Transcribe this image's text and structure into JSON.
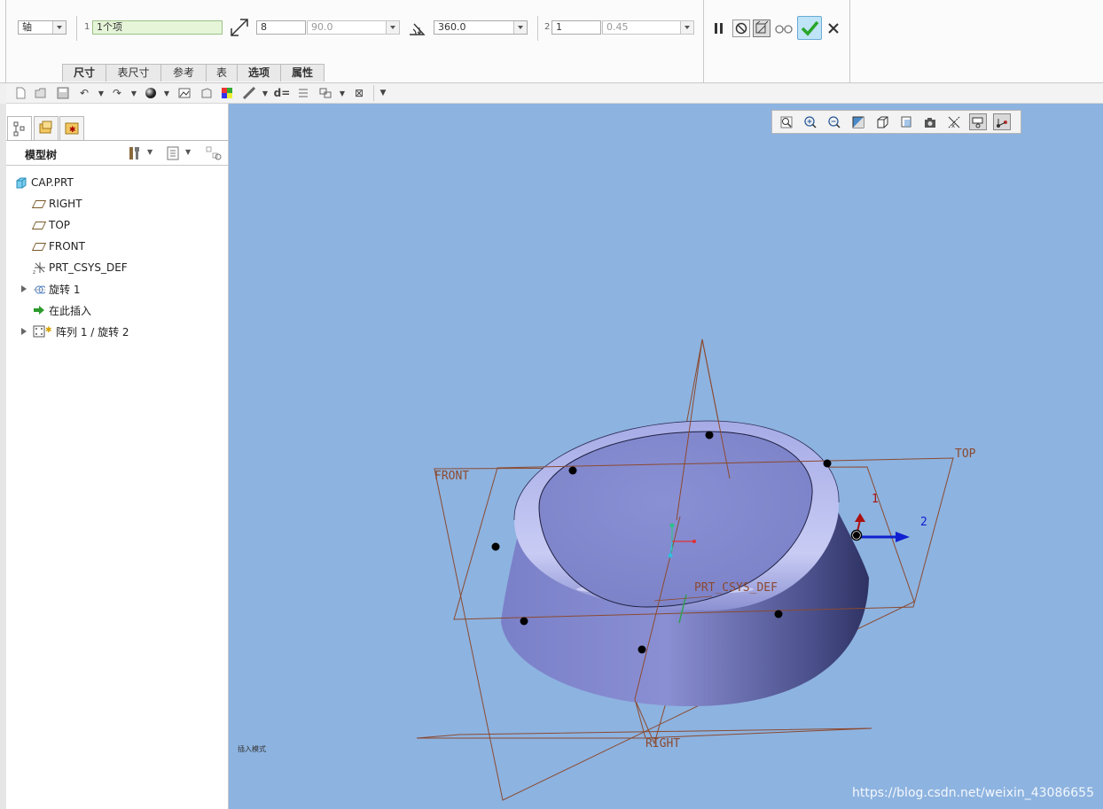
{
  "dashboard": {
    "type_combo": "轴",
    "refs": {
      "num": "1",
      "value": "1个项"
    },
    "count": {
      "value": "8"
    },
    "angle": {
      "value": "90.0"
    },
    "total_angle": {
      "value": "360.0"
    },
    "second": {
      "num": "2",
      "count": "1",
      "value": "0.45"
    },
    "tabs": [
      {
        "label": "尺寸"
      },
      {
        "label": "表尺寸"
      },
      {
        "label": "参考"
      },
      {
        "label": "表"
      },
      {
        "label": "选项"
      },
      {
        "label": "属性"
      }
    ]
  },
  "model_tree": {
    "title": "模型树",
    "items": [
      {
        "label": "CAP.PRT"
      },
      {
        "label": "RIGHT"
      },
      {
        "label": "TOP"
      },
      {
        "label": "FRONT"
      },
      {
        "label": "PRT_CSYS_DEF"
      },
      {
        "label": "旋转 1"
      },
      {
        "label": "在此插入"
      },
      {
        "label": "阵列 1 / 旋转 2"
      }
    ]
  },
  "viewport": {
    "labels": {
      "front": "FRONT",
      "top": "TOP",
      "right": "RIGHT",
      "csys": "PRT_CSYS_DEF",
      "axis1": "1",
      "axis2": "2"
    },
    "mode_text": "插入模式",
    "watermark": "https://blog.csdn.net/weixin_43086655"
  },
  "colors": {
    "viewport_bg": "#8db3e0",
    "model_fill": "#8e93d2",
    "datum_plane": "#8b4a30",
    "confirm_green": "#2aa52a"
  }
}
